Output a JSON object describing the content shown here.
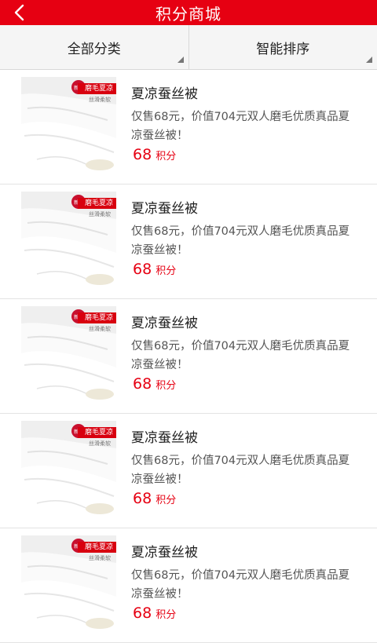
{
  "header": {
    "title": "积分商城",
    "back_icon": "chevron-left-icon",
    "color": "#e60012"
  },
  "filters": [
    {
      "label": "全部分类"
    },
    {
      "label": "智能排序"
    }
  ],
  "product_image": {
    "badge": "新品",
    "banner": "磨毛夏凉",
    "subtext": "丝滑柔软"
  },
  "items": [
    {
      "title": "夏凉蚕丝被",
      "description": "仅售68元，价值704元双人磨毛优质真品夏凉蚕丝被！",
      "points": "68",
      "points_unit": "积分"
    },
    {
      "title": "夏凉蚕丝被",
      "description": "仅售68元，价值704元双人磨毛优质真品夏凉蚕丝被！",
      "points": "68",
      "points_unit": "积分"
    },
    {
      "title": "夏凉蚕丝被",
      "description": "仅售68元，价值704元双人磨毛优质真品夏凉蚕丝被！",
      "points": "68",
      "points_unit": "积分"
    },
    {
      "title": "夏凉蚕丝被",
      "description": "仅售68元，价值704元双人磨毛优质真品夏凉蚕丝被！",
      "points": "68",
      "points_unit": "积分"
    },
    {
      "title": "夏凉蚕丝被",
      "description": "仅售68元，价值704元双人磨毛优质真品夏凉蚕丝被！",
      "points": "68",
      "points_unit": "积分"
    }
  ]
}
